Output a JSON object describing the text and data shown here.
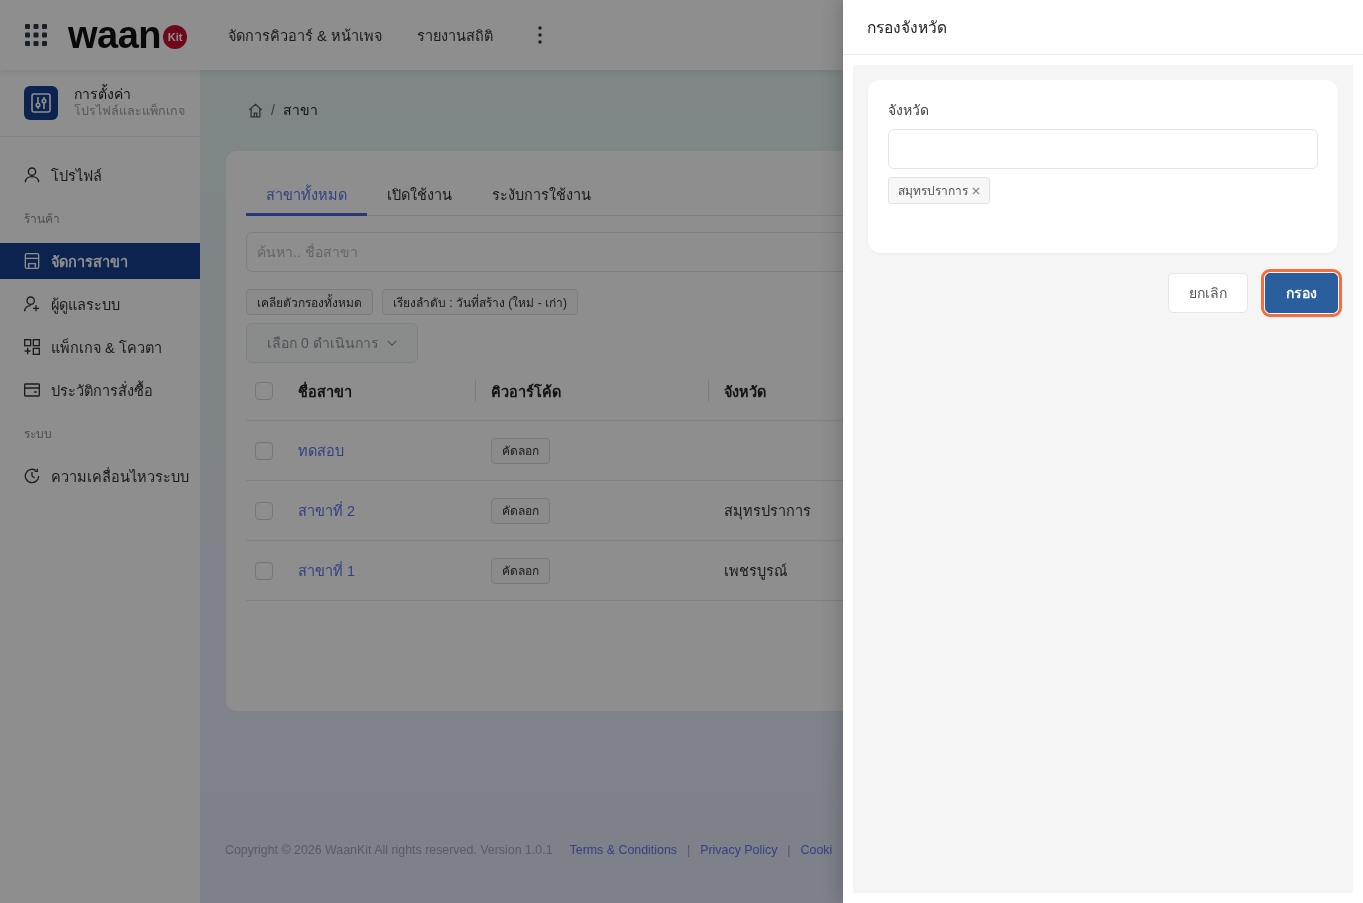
{
  "header": {
    "logo": {
      "word": "waan",
      "badge": "Kit"
    },
    "nav": [
      {
        "label": "จัดการคิวอาร์ & หน้าเพจ"
      },
      {
        "label": "รายงานสถิติ"
      }
    ]
  },
  "sidebar": {
    "title": "การตั้งค่า",
    "subtitle": "โปรไฟล์และแพ็กเกจ",
    "items": [
      {
        "kind": "link",
        "label": "โปรไฟล์",
        "selected": false
      },
      {
        "kind": "section",
        "label": "ร้านค้า"
      },
      {
        "kind": "link",
        "label": "จัดการสาขา",
        "selected": true
      },
      {
        "kind": "link",
        "label": "ผู้ดูแลระบบ",
        "selected": false
      },
      {
        "kind": "link",
        "label": "แพ็กเกจ & โควตา",
        "selected": false
      },
      {
        "kind": "link",
        "label": "ประวัติการสั่งซื้อ",
        "selected": false
      },
      {
        "kind": "section",
        "label": "ระบบ"
      },
      {
        "kind": "link",
        "label": "ความเคลื่อนไหวระบบ",
        "selected": false
      }
    ]
  },
  "breadcrumb": {
    "separator": "/",
    "current": "สาขา"
  },
  "branches": {
    "tabs": [
      {
        "label": "สาขาทั้งหมด",
        "selected": true
      },
      {
        "label": "เปิดใช้งาน",
        "selected": false
      },
      {
        "label": "ระงับการใช้งาน",
        "selected": false
      }
    ],
    "search": {
      "placeholder": "ค้นหา.. ชื่อสาขา"
    },
    "chips": [
      {
        "label": "เคลียตัวกรองทั้งหมด"
      },
      {
        "label": "เรียงลำดับ : วันที่สร้าง (ใหม่ - เก่า)"
      }
    ],
    "bulk_action": {
      "label": "เลือก 0 ดำเนินการ",
      "disabled": true
    },
    "table": {
      "select_all": {
        "checked": false
      },
      "columns": [
        "ชื่อสาขา",
        "คิวอาร์โค้ด",
        "จังหวัด"
      ],
      "rows": [
        {
          "checked": false,
          "name": "ทดสอบ",
          "qr_code": "คัดลอก"
        },
        {
          "checked": false,
          "name": "สาขาที่ 2",
          "qr_code": "คัดลอก",
          "province": "สมุทรปราการ"
        },
        {
          "checked": false,
          "name": "สาขาที่ 1",
          "qr_code": "คัดลอก",
          "province": "เพชรบูรณ์"
        }
      ]
    }
  },
  "footer": {
    "copyright": "Copyright © 2026 WaanKit All rights reserved. Version 1.0.1",
    "links": [
      {
        "label": "Terms & Conditions"
      },
      {
        "separator": "|",
        "label": "Privacy Policy"
      },
      {
        "separator": "|",
        "label": "Cooki"
      }
    ]
  },
  "drawer": {
    "title": "กรองจังหวัด",
    "field": {
      "label": "จังหวัด"
    },
    "tags": [
      {
        "label": "สมุทรปราการ"
      }
    ],
    "buttons": [
      {
        "kind": "secondary",
        "label": "ยกเลิก",
        "focused": false
      },
      {
        "kind": "primary",
        "label": "กรอง",
        "focused": true
      }
    ]
  }
}
